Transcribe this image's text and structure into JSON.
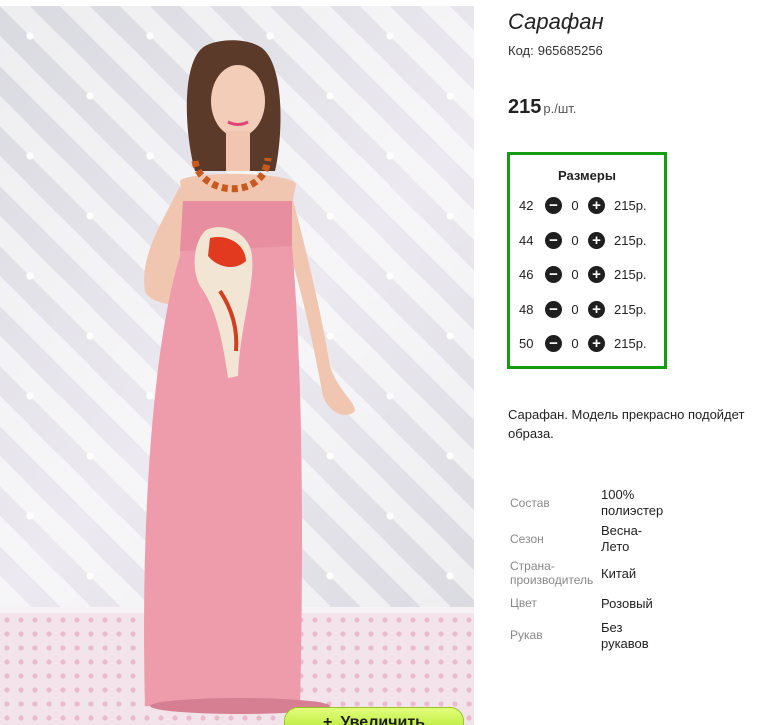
{
  "product": {
    "title": "Сарафан",
    "code_label": "Код:",
    "code": "965685256",
    "price": "215",
    "price_unit": "р./шт."
  },
  "sizes": {
    "title": "Размеры",
    "rows": [
      {
        "size": "42",
        "qty": "0",
        "price": "215р."
      },
      {
        "size": "44",
        "qty": "0",
        "price": "215р."
      },
      {
        "size": "46",
        "qty": "0",
        "price": "215р."
      },
      {
        "size": "48",
        "qty": "0",
        "price": "215р."
      },
      {
        "size": "50",
        "qty": "0",
        "price": "215р."
      }
    ]
  },
  "description": {
    "line1": "Сарафан. Модель прекрасно подойдет",
    "line2": "образа."
  },
  "specs": [
    {
      "label": "Состав",
      "value": "100% полиэстер"
    },
    {
      "label": "Сезон",
      "value": "Весна-Лето"
    },
    {
      "label": "Страна-производитель",
      "value": "Китай"
    },
    {
      "label": "Цвет",
      "value": "Розовый"
    },
    {
      "label": "Рукав",
      "value": "Без рукавов"
    }
  ],
  "zoom": {
    "plus": "+",
    "label": "Увеличить"
  },
  "colors": {
    "frame": "#129d12",
    "dress": "#ee9bac",
    "button": "#a9de23"
  },
  "icons": {
    "minus": "minus-circle-icon",
    "plus": "plus-circle-icon"
  }
}
